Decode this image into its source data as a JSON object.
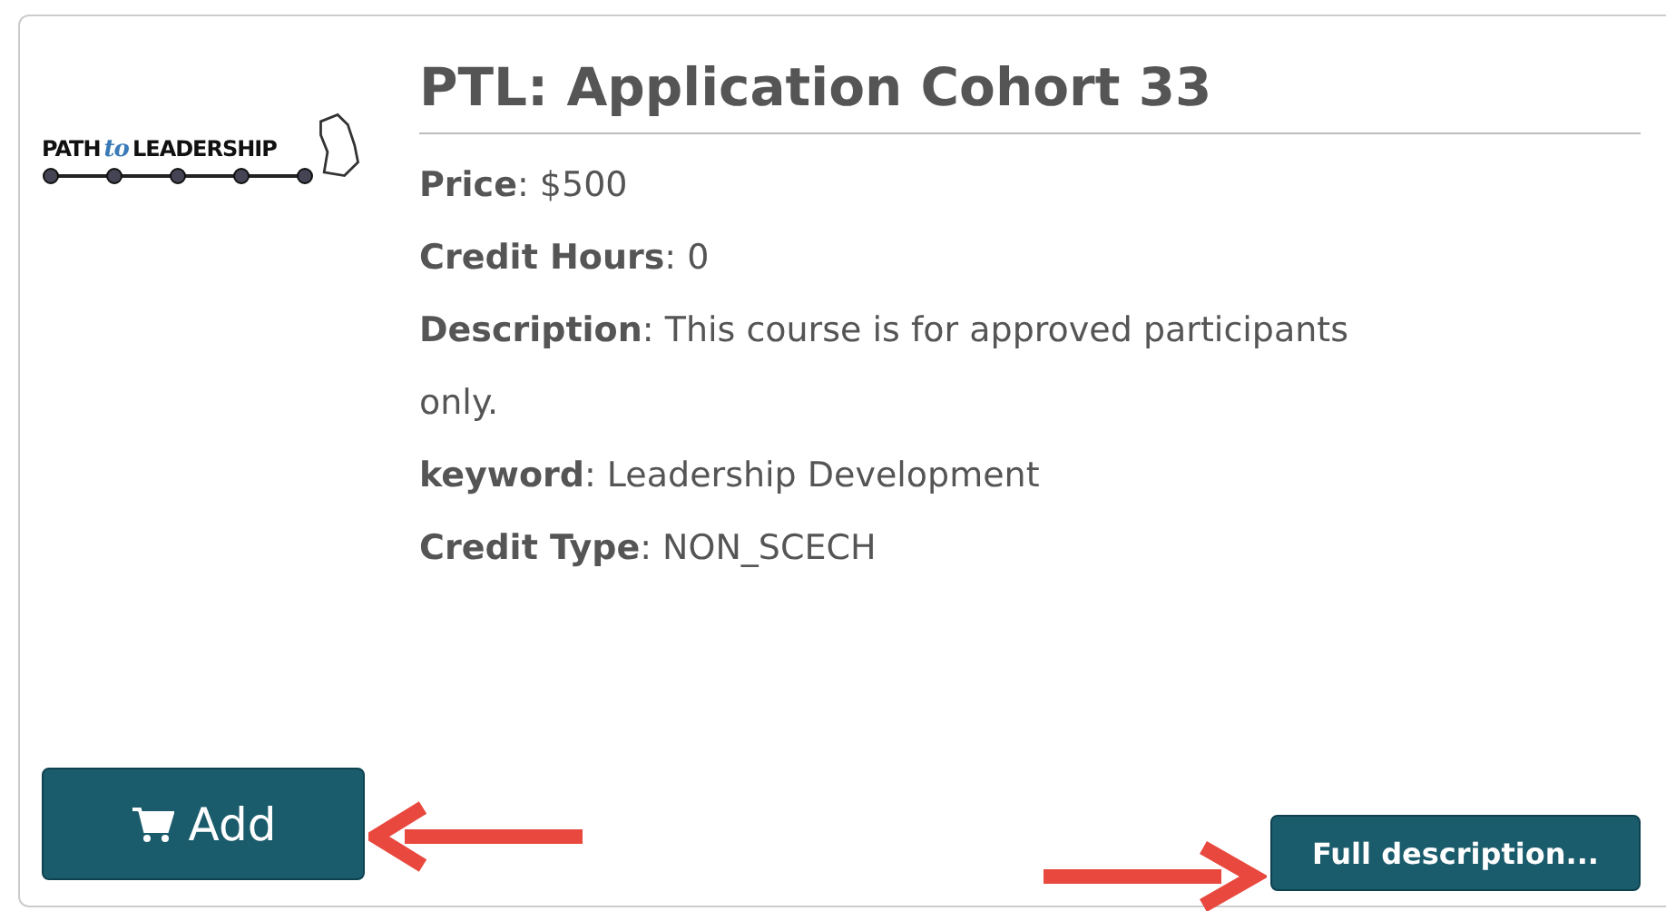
{
  "logo": {
    "word_left": "PATH",
    "word_mid": "to",
    "word_right": "LEADERSHIP"
  },
  "title": "PTL: Application Cohort 33",
  "fields": [
    {
      "text": "**Price**: $500"
    },
    {
      "text": "**Credit Hours**: 0"
    },
    {
      "text": "**Description**: This course is for approved participants only."
    },
    {
      "text": "**keyword**: Leadership Development"
    },
    {
      "text": "**Credit Type**: NON_SCECH"
    }
  ],
  "buttons": {
    "add": "Add",
    "full_description": "Full description..."
  }
}
